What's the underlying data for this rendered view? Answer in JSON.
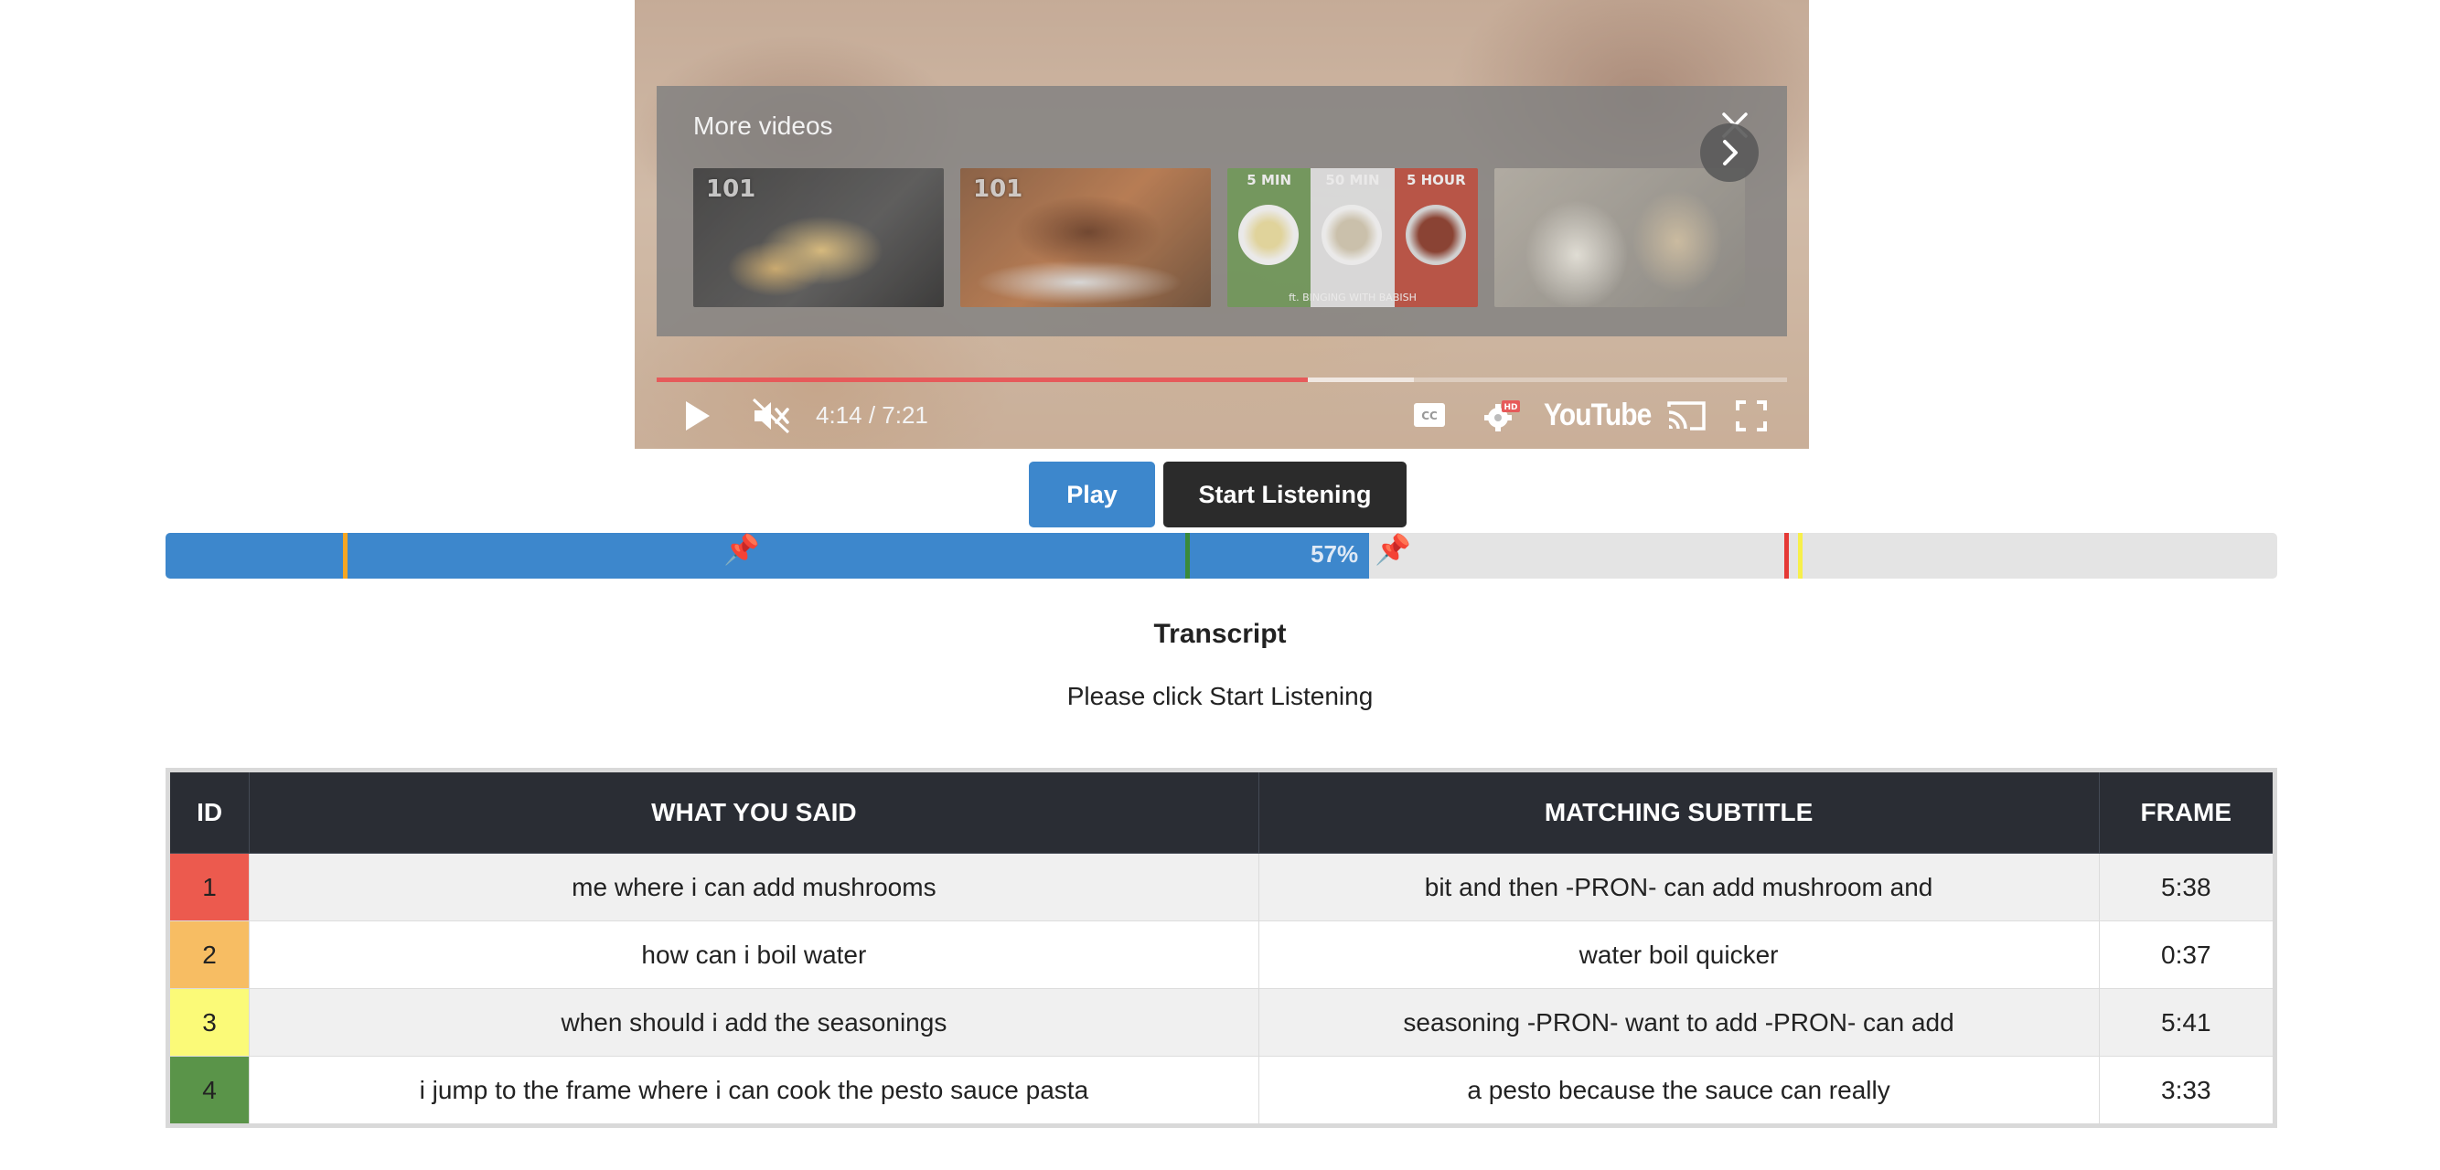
{
  "player": {
    "more_videos_title": "More videos",
    "thumbnails": [
      {
        "badge": "101",
        "kind": "pasta"
      },
      {
        "badge": "101",
        "kind": "chicken"
      },
      {
        "badge": "",
        "kind": "noodles-comparison",
        "segments": [
          "5 MIN",
          "50 MIN",
          "5 HOUR"
        ],
        "subtitle": "ft. BINGING WITH BABISH"
      },
      {
        "badge": "",
        "kind": "onions"
      }
    ],
    "time": "4:14 / 7:21",
    "played_fraction": 0.576,
    "buffered_fraction": 0.67,
    "youtube_label": "YouTube",
    "hd_badge": "HD",
    "icons": [
      "play-icon",
      "mute-icon",
      "captions-icon",
      "settings-icon",
      "youtube-logo",
      "cast-icon",
      "fullscreen-icon",
      "close-icon",
      "chevron-right-icon"
    ]
  },
  "buttons": {
    "play": "Play",
    "start_listening": "Start Listening"
  },
  "timeline": {
    "progress_percent": 57,
    "progress_label": "57%",
    "fill_color": "#3d87cc",
    "markers": [
      {
        "id": 2,
        "frame": "0:37",
        "color": "#f5a623"
      },
      {
        "id": 4,
        "frame": "3:33",
        "color": "#3a8a3a"
      },
      {
        "id": 1,
        "frame": "5:38",
        "color": "#e53935"
      },
      {
        "id": 3,
        "frame": "5:41",
        "color": "#f7f04a"
      }
    ],
    "total_seconds": 441
  },
  "transcript": {
    "title": "Transcript",
    "hint": "Please click Start Listening"
  },
  "table": {
    "headers": {
      "id": "ID",
      "said": "WHAT YOU SAID",
      "subtitle": "MATCHING SUBTITLE",
      "frame": "FRAME"
    },
    "rows": [
      {
        "id": "1",
        "said": "me where i can add mushrooms",
        "subtitle": "bit and then -PRON- can add mushroom and",
        "frame": "5:38",
        "color": "#ec5a4e"
      },
      {
        "id": "2",
        "said": "how can i boil water",
        "subtitle": "water boil quicker",
        "frame": "0:37",
        "color": "#f7bd63"
      },
      {
        "id": "3",
        "said": "when should i add the seasonings",
        "subtitle": "seasoning -PRON- want to add -PRON- can add",
        "frame": "5:41",
        "color": "#fbfa78"
      },
      {
        "id": "4",
        "said": "i jump to the frame where i can cook the pesto sauce pasta",
        "subtitle": "a pesto because the sauce can really",
        "frame": "3:33",
        "color": "#5a9449"
      }
    ]
  }
}
